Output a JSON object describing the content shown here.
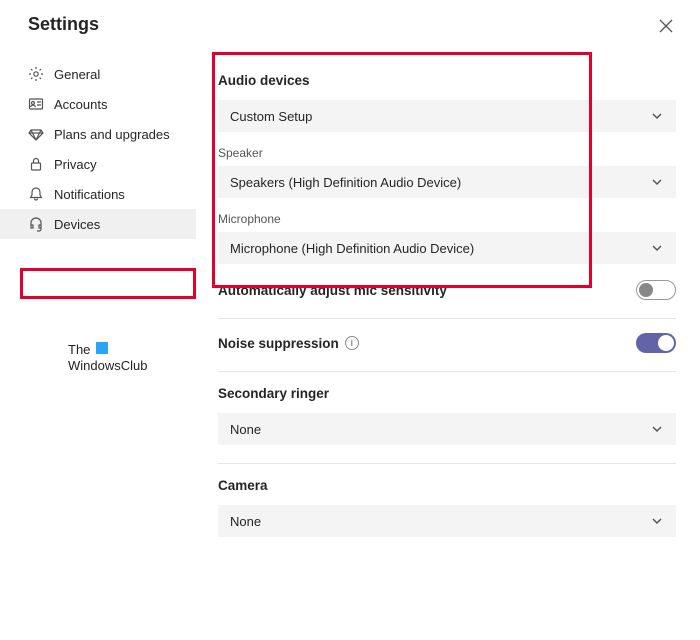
{
  "title": "Settings",
  "sidebar": {
    "items": [
      {
        "label": "General"
      },
      {
        "label": "Accounts"
      },
      {
        "label": "Plans and upgrades"
      },
      {
        "label": "Privacy"
      },
      {
        "label": "Notifications"
      },
      {
        "label": "Devices"
      }
    ]
  },
  "audio": {
    "section_title": "Audio devices",
    "device_profile": "Custom Setup",
    "speaker_label": "Speaker",
    "speaker_value": "Speakers (High Definition Audio Device)",
    "mic_label": "Microphone",
    "mic_value": "Microphone (High Definition Audio Device)"
  },
  "auto_mic": {
    "label": "Automatically adjust mic sensitivity",
    "enabled": false
  },
  "noise": {
    "label": "Noise suppression",
    "enabled": true
  },
  "secondary_ringer": {
    "label": "Secondary ringer",
    "value": "None"
  },
  "camera": {
    "label": "Camera",
    "value": "None"
  },
  "watermark": {
    "line1": "The",
    "line2": "WindowsClub"
  }
}
